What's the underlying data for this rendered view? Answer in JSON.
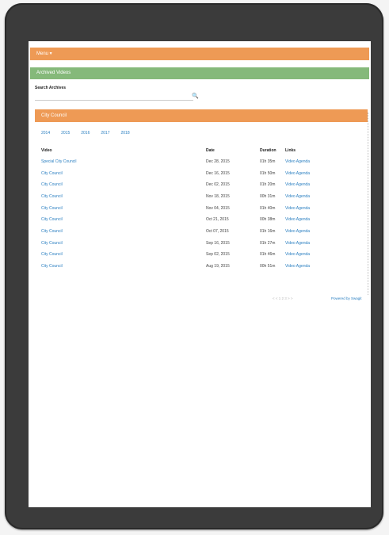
{
  "header": {
    "orange_bar": "Menu ▾",
    "green_bar": "Archived Videos"
  },
  "search": {
    "label": "Search Archives",
    "value": ""
  },
  "section": {
    "title": "City Council"
  },
  "years": [
    "2014",
    "2015",
    "2016",
    "2017",
    "2018"
  ],
  "table": {
    "headers": {
      "video": "Video",
      "date": "Date",
      "duration": "Duration",
      "links": "Links"
    },
    "rows": [
      {
        "video": "Special City Council",
        "date": "Dec 28, 2015",
        "duration": "01h 35m",
        "links": "Video  Agenda"
      },
      {
        "video": "City Council",
        "date": "Dec 16, 2015",
        "duration": "01h 50m",
        "links": "Video  Agenda"
      },
      {
        "video": "City Council",
        "date": "Dec 02, 2015",
        "duration": "01h 20m",
        "links": "Video  Agenda"
      },
      {
        "video": "City Council",
        "date": "Nov 18, 2015",
        "duration": "00h 31m",
        "links": "Video  Agenda"
      },
      {
        "video": "City Council",
        "date": "Nov 04, 2015",
        "duration": "01h 40m",
        "links": "Video  Agenda"
      },
      {
        "video": "City Council",
        "date": "Oct 21, 2015",
        "duration": "00h 38m",
        "links": "Video  Agenda"
      },
      {
        "video": "City Council",
        "date": "Oct 07, 2015",
        "duration": "01h 16m",
        "links": "Video  Agenda"
      },
      {
        "video": "City Council",
        "date": "Sep 16, 2015",
        "duration": "01h 27m",
        "links": "Video  Agenda"
      },
      {
        "video": "City Council",
        "date": "Sep 02, 2015",
        "duration": "01h 46m",
        "links": "Video  Agenda"
      },
      {
        "video": "City Council",
        "date": "Aug 19, 2015",
        "duration": "00h 51m",
        "links": "Video  Agenda"
      }
    ]
  },
  "footer": {
    "pager": "< < 1 2 3 > >",
    "powered": "Powered by Swagit"
  }
}
